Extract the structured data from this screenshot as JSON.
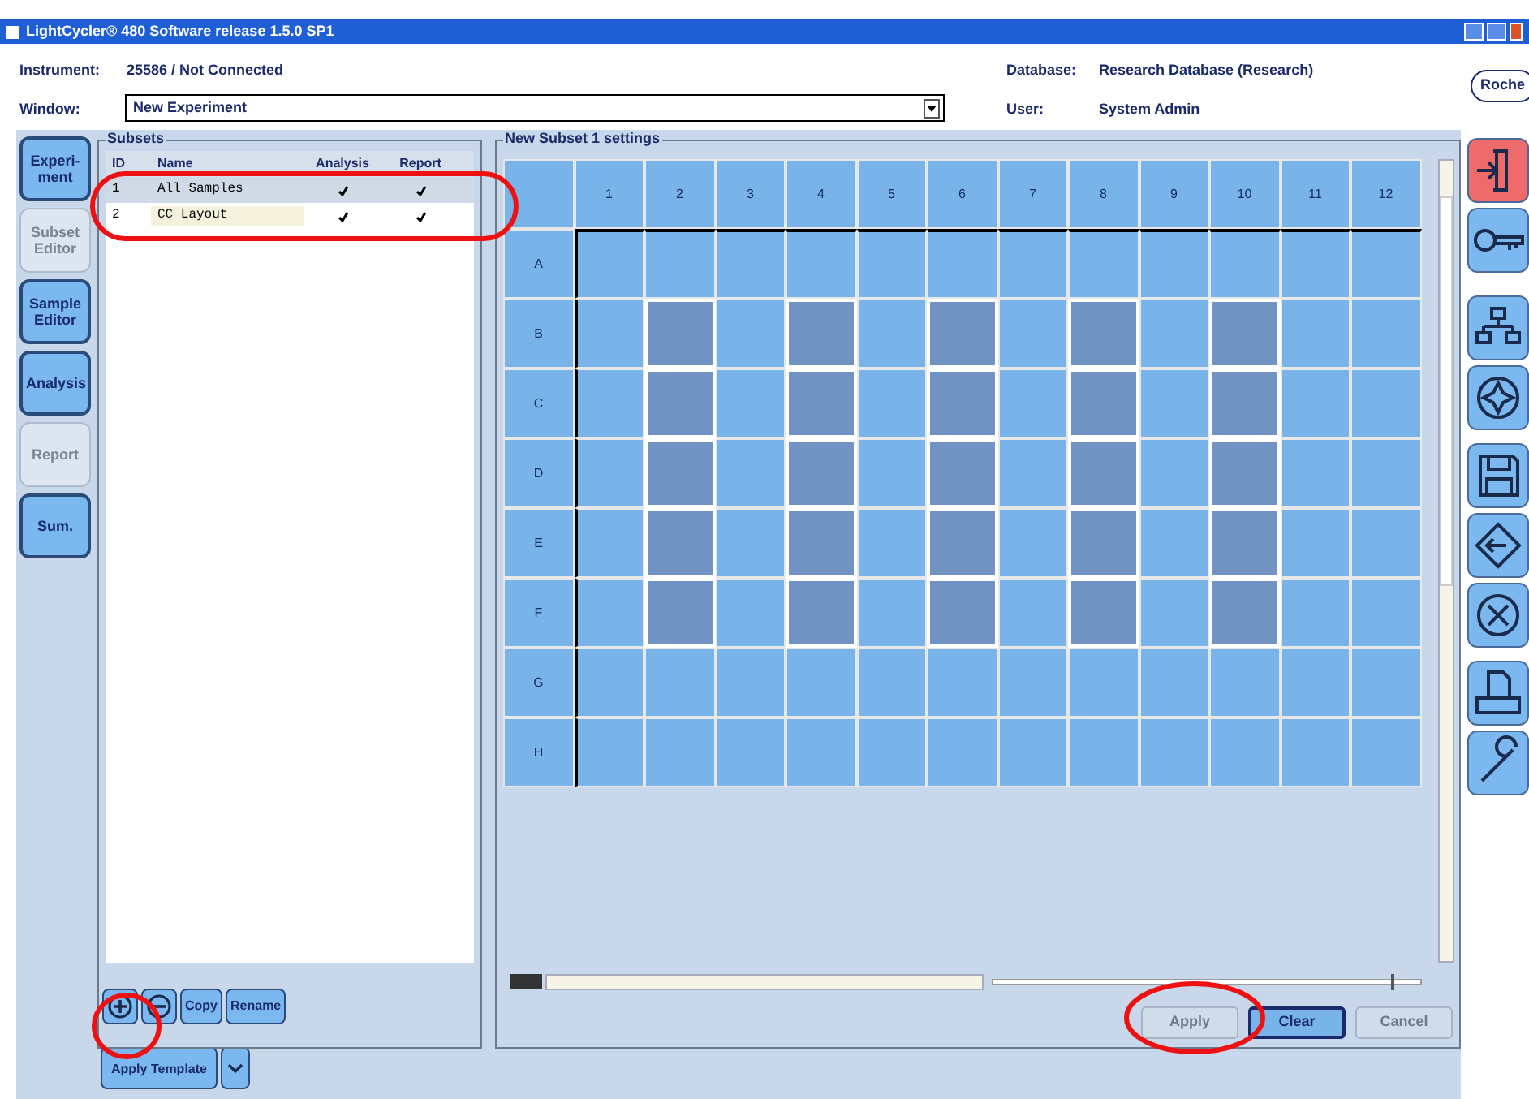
{
  "window": {
    "title": "LightCycler® 480 Software release 1.5.0 SP1"
  },
  "header": {
    "instrument_label": "Instrument:",
    "instrument_value": "25586 / Not Connected",
    "window_label": "Window:",
    "window_value": "New Experiment",
    "database_label": "Database:",
    "database_value": "Research Database (Research)",
    "user_label": "User:",
    "user_value": "System Admin",
    "logo": "Roche"
  },
  "nav": [
    {
      "label": "Experi-ment",
      "disabled": false
    },
    {
      "label": "Subset Editor",
      "disabled": true
    },
    {
      "label": "Sample Editor",
      "disabled": false
    },
    {
      "label": "Analysis",
      "disabled": false
    },
    {
      "label": "Report",
      "disabled": true
    },
    {
      "label": "Sum.",
      "disabled": false
    }
  ],
  "subsets": {
    "title": "Subsets",
    "columns": [
      "ID",
      "Name",
      "Analysis",
      "Report"
    ],
    "rows": [
      {
        "id": "1",
        "name": "All Samples",
        "analysis": true,
        "report": true,
        "selected": true
      },
      {
        "id": "2",
        "name": "CC Layout",
        "analysis": true,
        "report": true,
        "selected": false
      }
    ],
    "buttons": [
      {
        "kind": "add"
      },
      {
        "kind": "remove"
      },
      {
        "kind": "text",
        "label": "Copy"
      },
      {
        "kind": "text",
        "label": "Rename"
      }
    ],
    "apply_template": "Apply Template"
  },
  "settings": {
    "title": "New Subset 1 settings",
    "columns": [
      "1",
      "2",
      "3",
      "4",
      "5",
      "6",
      "7",
      "8",
      "9",
      "10",
      "11",
      "12"
    ],
    "rows": [
      {
        "label": "A",
        "wells": [
          false,
          false,
          false,
          false,
          false,
          false,
          false,
          false,
          false,
          false,
          false,
          false
        ]
      },
      {
        "label": "B",
        "wells": [
          false,
          true,
          false,
          true,
          false,
          true,
          false,
          true,
          false,
          true,
          false,
          false
        ]
      },
      {
        "label": "C",
        "wells": [
          false,
          true,
          false,
          true,
          false,
          true,
          false,
          true,
          false,
          true,
          false,
          false
        ]
      },
      {
        "label": "D",
        "wells": [
          false,
          true,
          false,
          true,
          false,
          true,
          false,
          true,
          false,
          true,
          false,
          false
        ]
      },
      {
        "label": "E",
        "wells": [
          false,
          true,
          false,
          true,
          false,
          true,
          false,
          true,
          false,
          true,
          false,
          false
        ]
      },
      {
        "label": "F",
        "wells": [
          false,
          true,
          false,
          true,
          false,
          true,
          false,
          true,
          false,
          true,
          false,
          false
        ]
      },
      {
        "label": "G",
        "wells": [
          false,
          false,
          false,
          false,
          false,
          false,
          false,
          false,
          false,
          false,
          false,
          false
        ]
      },
      {
        "label": "H",
        "wells": [
          false,
          false,
          false,
          false,
          false,
          false,
          false,
          false,
          false,
          false,
          false,
          false
        ]
      }
    ],
    "buttons": [
      {
        "label": "Apply",
        "disabled": true
      },
      {
        "label": "Clear",
        "disabled": false
      },
      {
        "label": "Cancel",
        "disabled": true
      }
    ]
  },
  "toolbar": [
    {
      "kind": "exit"
    },
    {
      "kind": "key"
    },
    {
      "kind": "network"
    },
    {
      "kind": "compass"
    },
    {
      "kind": "save"
    },
    {
      "kind": "diamond"
    },
    {
      "kind": "cancel"
    },
    {
      "kind": "print"
    },
    {
      "kind": "wrench"
    }
  ]
}
